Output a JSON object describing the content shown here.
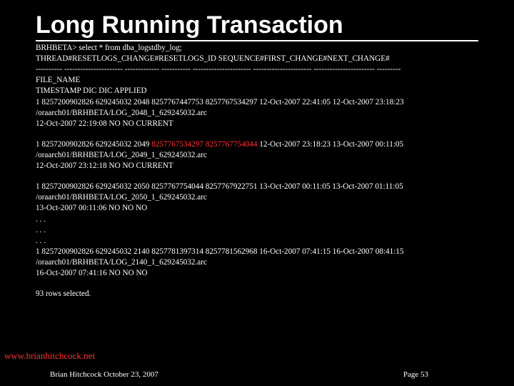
{
  "title": "Long Running Transaction",
  "block1": {
    "l1": "BRHBETA> select * from dba_logstdby_log;",
    "l2": "THREAD#RESETLOGS_CHANGE#RESETLOGS_ID SEQUENCE#FIRST_CHANGE#NEXT_CHANGE#",
    "l3": "---------- ---------------------- ------------- ----------- ---------------------- ---------------------- ----------------------- ---------",
    "l4": "FILE_NAME",
    "l5": "TIMESTAMP DIC DIC APPLIED",
    "l6": "1 8257200902826 629245032 2048 8257767447753 8257767534297 12-Oct-2007 22:41:05 12-Oct-2007 23:18:23",
    "l7": "/oraarch01/BRHBETA/LOG_2048_1_629245032.arc",
    "l8": "12-Oct-2007 22:19:08 NO NO CURRENT"
  },
  "block2": {
    "l1a": "1 8257200902826 629245032 2049 ",
    "l1b": "8257767534297 8257767754044",
    "l1c": " 12-Oct-2007 23:18:23 13-Oct-2007 00:11:05",
    "l2": "/oraarch01/BRHBETA/LOG_2049_1_629245032.arc",
    "l3": "12-Oct-2007 23:12:18 NO NO CURRENT"
  },
  "block3": {
    "l1": "1 8257200902826 629245032 2050 8257767754044 8257767922751 13-Oct-2007 00:11:05 13-Oct-2007 01:11:05",
    "l2": "/oraarch01/BRHBETA/LOG_2050_1_629245032.arc",
    "l3": "13-Oct-2007 00:11:06 NO NO NO",
    "l4": ". . .",
    "l5": ". . .",
    "l6": ". . .",
    "l7": "1 8257200902826 629245032 2140 8257781397314 8257781562968 16-Oct-2007 07:41:15 16-Oct-2007 08:41:15",
    "l8": "/oraarch01/BRHBETA/LOG_2140_1_629245032.arc",
    "l9": "16-Oct-2007 07:41:16 NO NO NO"
  },
  "rows": "93 rows selected.",
  "url": "www.brianhitchcock.net",
  "footer": {
    "left": "Brian Hitchcock  October 23, 2007",
    "right": "Page 53"
  }
}
